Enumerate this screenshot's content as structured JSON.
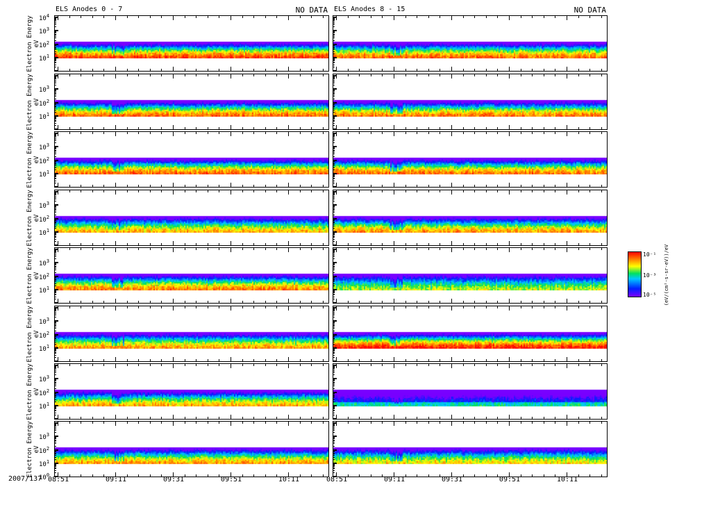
{
  "chart_data": {
    "type": "heatmap",
    "date_label": "2007/137",
    "x_ticks": [
      "08:51",
      "09:11",
      "09:31",
      "09:51",
      "10:11"
    ],
    "x_range_minutes": [
      0,
      94
    ],
    "y_label": "Electron Energy",
    "y_unit": "eV",
    "y_scale": "log",
    "y_range": [
      1,
      10000
    ],
    "y_tick_exponents": [
      0,
      1,
      2,
      3,
      4
    ],
    "columns": [
      {
        "title": "ELS Anodes 0 - 7",
        "status": "NO DATA"
      },
      {
        "title": "ELS Anodes 8 - 15",
        "status": "NO DATA"
      }
    ],
    "panels": [
      {
        "col": 0,
        "row": 0,
        "band_eV": [
          10,
          140
        ],
        "peak": 1.0
      },
      {
        "col": 1,
        "row": 0,
        "band_eV": [
          10,
          140
        ],
        "peak": 0.95
      },
      {
        "col": 0,
        "row": 1,
        "band_eV": [
          10,
          140
        ],
        "peak": 0.95
      },
      {
        "col": 1,
        "row": 1,
        "band_eV": [
          10,
          140
        ],
        "peak": 0.93
      },
      {
        "col": 0,
        "row": 2,
        "band_eV": [
          10,
          140
        ],
        "peak": 0.95
      },
      {
        "col": 1,
        "row": 2,
        "band_eV": [
          10,
          140
        ],
        "peak": 0.93
      },
      {
        "col": 0,
        "row": 3,
        "band_eV": [
          10,
          140
        ],
        "peak": 0.85
      },
      {
        "col": 1,
        "row": 3,
        "band_eV": [
          10,
          140
        ],
        "peak": 0.88
      },
      {
        "col": 0,
        "row": 4,
        "band_eV": [
          10,
          140
        ],
        "peak": 0.92
      },
      {
        "col": 1,
        "row": 4,
        "band_eV": [
          10,
          140
        ],
        "peak": 0.72
      },
      {
        "col": 0,
        "row": 5,
        "band_eV": [
          10,
          140
        ],
        "peak": 0.88
      },
      {
        "col": 1,
        "row": 5,
        "band_eV": [
          10,
          140
        ],
        "peak": 1.05
      },
      {
        "col": 0,
        "row": 6,
        "band_eV": [
          10,
          140
        ],
        "peak": 0.86
      },
      {
        "col": 1,
        "row": 6,
        "band_eV": [
          10,
          140
        ],
        "peak": 0.6
      },
      {
        "col": 0,
        "row": 7,
        "band_eV": [
          10,
          140
        ],
        "peak": 0.88
      },
      {
        "col": 1,
        "row": 7,
        "band_eV": [
          10,
          140
        ],
        "peak": 0.8
      }
    ],
    "colorbar": {
      "label": "(eV/(cm²-s-sr-eV))/eV",
      "tick_labels": [
        "10⁻¹",
        "10⁻³",
        "10⁻⁵"
      ]
    }
  }
}
